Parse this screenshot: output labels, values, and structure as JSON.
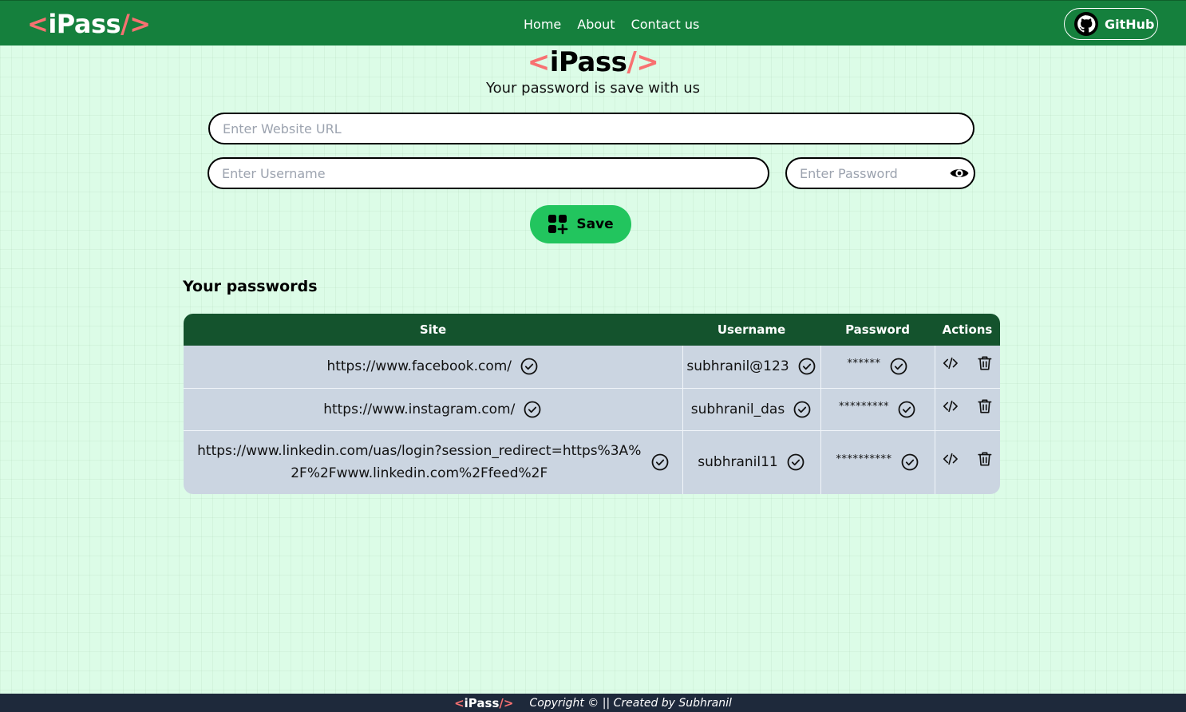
{
  "navbar": {
    "logo": {
      "open": "<",
      "name": "iPass",
      "close": "/>"
    },
    "links": [
      "Home",
      "About",
      "Contact us"
    ],
    "github_label": "GitHub"
  },
  "hero": {
    "logo": {
      "open": "<",
      "name": "iPass",
      "close": "/>"
    },
    "tagline": "Your password is save with us"
  },
  "form": {
    "url_placeholder": "Enter Website URL",
    "username_placeholder": "Enter Username",
    "password_placeholder": "Enter Password",
    "save_label": "Save"
  },
  "passwords": {
    "title": "Your passwords",
    "headers": [
      "Site",
      "Username",
      "Password",
      "Actions"
    ],
    "rows": [
      {
        "site": "https://www.facebook.com/",
        "username": "subhranil@123",
        "password": "******"
      },
      {
        "site": "https://www.instagram.com/",
        "username": "subhranil_das",
        "password": "*********"
      },
      {
        "site": "https://www.linkedin.com/uas/login?session_redirect=https%3A%2F%2Fwww.linkedin.com%2Ffeed%2F",
        "username": "subhranil11",
        "password": "**********"
      }
    ]
  },
  "footer": {
    "logo": {
      "open": "<",
      "name": "iPass",
      "close": "/>"
    },
    "text": "Copyright © || Created by Subhranil"
  },
  "icons": {
    "github": "github-icon",
    "eye": "eye-icon",
    "save": "add-grid-icon",
    "copy": "check-circle-icon",
    "edit": "code-icon",
    "delete": "trash-icon"
  },
  "colors": {
    "navbar": "#15803d",
    "accent": "#f87171",
    "save_button": "#22c55e",
    "table_header": "#14532d",
    "table_row": "#cbd5e1",
    "footer": "#1e293b",
    "background": "#dcfce7"
  }
}
